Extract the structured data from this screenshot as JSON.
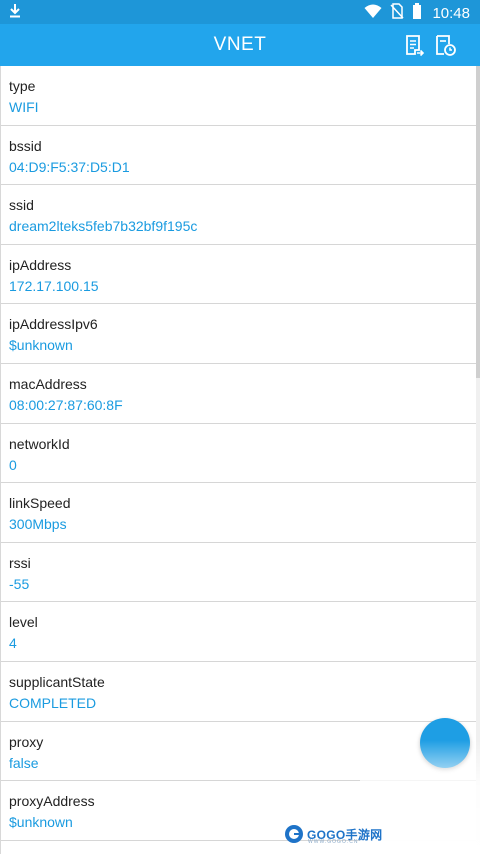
{
  "status_bar": {
    "time": "10:48",
    "icons": [
      "download-icon",
      "wifi-icon",
      "no-sim-icon",
      "battery-icon"
    ]
  },
  "app_bar": {
    "title": "VNET",
    "actions": [
      "log-list-icon",
      "history-icon"
    ]
  },
  "items": [
    {
      "key": "type",
      "value": "WIFI"
    },
    {
      "key": "bssid",
      "value": "04:D9:F5:37:D5:D1"
    },
    {
      "key": "ssid",
      "value": "dream2lteks5feb7b32bf9f195c"
    },
    {
      "key": "ipAddress",
      "value": "172.17.100.15"
    },
    {
      "key": "ipAddressIpv6",
      "value": "$unknown"
    },
    {
      "key": "macAddress",
      "value": "08:00:27:87:60:8F"
    },
    {
      "key": "networkId",
      "value": "0"
    },
    {
      "key": "linkSpeed",
      "value": "300Mbps"
    },
    {
      "key": "rssi",
      "value": "-55"
    },
    {
      "key": "level",
      "value": "4"
    },
    {
      "key": "supplicantState",
      "value": "COMPLETED"
    },
    {
      "key": "proxy",
      "value": "false"
    },
    {
      "key": "proxyAddress",
      "value": "$unknown"
    }
  ],
  "watermark": {
    "text": "GOGO手游网",
    "subtext": "WWW.GOGO.CN"
  },
  "colors": {
    "status_bar": "#1e96d8",
    "app_bar": "#22a5ec",
    "value_text": "#1a9be0",
    "fab": "#1e9ee4"
  }
}
